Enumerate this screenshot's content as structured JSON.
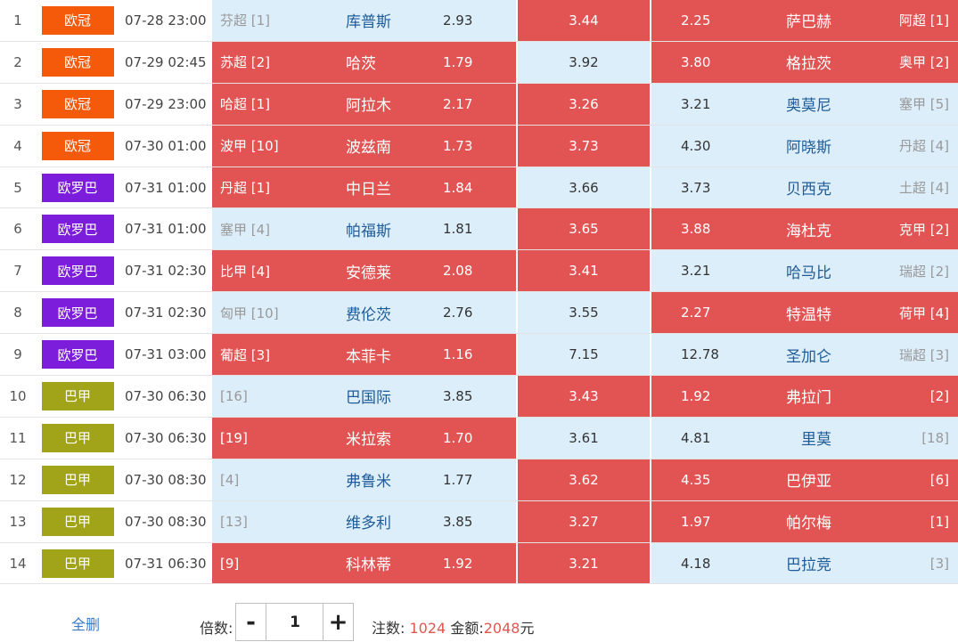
{
  "colors": {
    "euro_cup": "#f55a0a",
    "europa": "#7b1ddb",
    "brazil": "#a1a319",
    "red_cell": "#e25453",
    "blue_cell": "#ddeefb",
    "link_blue": "#1f5c97",
    "highlight": "#e0574f"
  },
  "matches": [
    {
      "num": "1",
      "league": "欧冠",
      "league_color": "#f55a0a",
      "time": "07-28 23:00",
      "home_rank": "芬超 [1]",
      "home": "库普斯",
      "home_odds": "2.93",
      "draw_odds": "3.44",
      "away_odds": "2.25",
      "away": "萨巴赫",
      "away_rank": "阿超 [1]",
      "cells": [
        "blue",
        "red",
        "red"
      ]
    },
    {
      "num": "2",
      "league": "欧冠",
      "league_color": "#f55a0a",
      "time": "07-29 02:45",
      "home_rank": "苏超 [2]",
      "home": "哈茨",
      "home_odds": "1.79",
      "draw_odds": "3.92",
      "away_odds": "3.80",
      "away": "格拉茨",
      "away_rank": "奥甲 [2]",
      "cells": [
        "red",
        "blue",
        "red"
      ]
    },
    {
      "num": "3",
      "league": "欧冠",
      "league_color": "#f55a0a",
      "time": "07-29 23:00",
      "home_rank": "哈超 [1]",
      "home": "阿拉木",
      "home_odds": "2.17",
      "draw_odds": "3.26",
      "away_odds": "3.21",
      "away": "奥莫尼",
      "away_rank": "塞甲 [5]",
      "cells": [
        "red",
        "red",
        "blue"
      ]
    },
    {
      "num": "4",
      "league": "欧冠",
      "league_color": "#f55a0a",
      "time": "07-30 01:00",
      "home_rank": "波甲 [10]",
      "home": "波兹南",
      "home_odds": "1.73",
      "draw_odds": "3.73",
      "away_odds": "4.30",
      "away": "阿晓斯",
      "away_rank": "丹超 [4]",
      "cells": [
        "red",
        "red",
        "blue"
      ]
    },
    {
      "num": "5",
      "league": "欧罗巴",
      "league_color": "#7b1ddb",
      "time": "07-31 01:00",
      "home_rank": "丹超 [1]",
      "home": "中日兰",
      "home_odds": "1.84",
      "draw_odds": "3.66",
      "away_odds": "3.73",
      "away": "贝西克",
      "away_rank": "土超 [4]",
      "cells": [
        "red",
        "blue",
        "blue"
      ]
    },
    {
      "num": "6",
      "league": "欧罗巴",
      "league_color": "#7b1ddb",
      "time": "07-31 01:00",
      "home_rank": "塞甲 [4]",
      "home": "帕福斯",
      "home_odds": "1.81",
      "draw_odds": "3.65",
      "away_odds": "3.88",
      "away": "海杜克",
      "away_rank": "克甲 [2]",
      "cells": [
        "blue",
        "red",
        "red"
      ]
    },
    {
      "num": "7",
      "league": "欧罗巴",
      "league_color": "#7b1ddb",
      "time": "07-31 02:30",
      "home_rank": "比甲 [4]",
      "home": "安德莱",
      "home_odds": "2.08",
      "draw_odds": "3.41",
      "away_odds": "3.21",
      "away": "哈马比",
      "away_rank": "瑞超 [2]",
      "cells": [
        "red",
        "red",
        "blue"
      ]
    },
    {
      "num": "8",
      "league": "欧罗巴",
      "league_color": "#7b1ddb",
      "time": "07-31 02:30",
      "home_rank": "匈甲 [10]",
      "home": "费伦茨",
      "home_odds": "2.76",
      "draw_odds": "3.55",
      "away_odds": "2.27",
      "away": "特温特",
      "away_rank": "荷甲 [4]",
      "cells": [
        "blue",
        "blue",
        "red"
      ]
    },
    {
      "num": "9",
      "league": "欧罗巴",
      "league_color": "#7b1ddb",
      "time": "07-31 03:00",
      "home_rank": "葡超 [3]",
      "home": "本菲卡",
      "home_odds": "1.16",
      "draw_odds": "7.15",
      "away_odds": "12.78",
      "away": "圣加仑",
      "away_rank": "瑞超 [3]",
      "cells": [
        "red",
        "blue",
        "blue"
      ]
    },
    {
      "num": "10",
      "league": "巴甲",
      "league_color": "#a1a319",
      "time": "07-30 06:30",
      "home_rank": "[16]",
      "home": "巴国际",
      "home_odds": "3.85",
      "draw_odds": "3.43",
      "away_odds": "1.92",
      "away": "弗拉门",
      "away_rank": "[2]",
      "cells": [
        "blue",
        "red",
        "red"
      ]
    },
    {
      "num": "11",
      "league": "巴甲",
      "league_color": "#a1a319",
      "time": "07-30 06:30",
      "home_rank": "[19]",
      "home": "米拉索",
      "home_odds": "1.70",
      "draw_odds": "3.61",
      "away_odds": "4.81",
      "away": "里莫",
      "away_rank": "[18]",
      "cells": [
        "red",
        "blue",
        "blue"
      ]
    },
    {
      "num": "12",
      "league": "巴甲",
      "league_color": "#a1a319",
      "time": "07-30 08:30",
      "home_rank": "[4]",
      "home": "弗鲁米",
      "home_odds": "1.77",
      "draw_odds": "3.62",
      "away_odds": "4.35",
      "away": "巴伊亚",
      "away_rank": "[6]",
      "cells": [
        "blue",
        "red",
        "red"
      ]
    },
    {
      "num": "13",
      "league": "巴甲",
      "league_color": "#a1a319",
      "time": "07-30 08:30",
      "home_rank": "[13]",
      "home": "维多利",
      "home_odds": "3.85",
      "draw_odds": "3.27",
      "away_odds": "1.97",
      "away": "帕尔梅",
      "away_rank": "[1]",
      "cells": [
        "blue",
        "red",
        "red"
      ]
    },
    {
      "num": "14",
      "league": "巴甲",
      "league_color": "#a1a319",
      "time": "07-31 06:30",
      "home_rank": "[9]",
      "home": "科林蒂",
      "home_odds": "1.92",
      "draw_odds": "3.21",
      "away_odds": "4.18",
      "away": "巴拉竞",
      "away_rank": "[3]",
      "cells": [
        "red",
        "red",
        "blue"
      ]
    }
  ],
  "footer": {
    "clear_all": "全删",
    "multiplier_label": "倍数:",
    "minus": "-",
    "multiplier_value": "1",
    "plus": "+",
    "bets_label": "注数:",
    "bets_count": "1024",
    "amount_label": "金额:",
    "amount_value": "2048",
    "currency": "元"
  }
}
